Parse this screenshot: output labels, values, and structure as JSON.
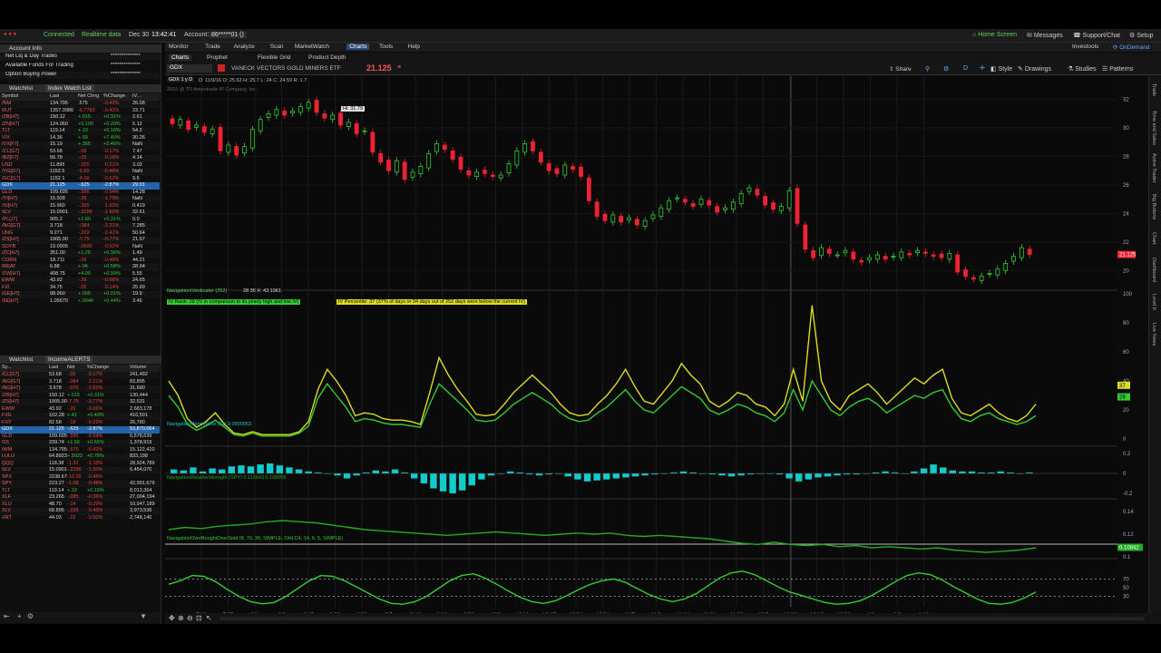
{
  "topbar": {
    "connected": "Connected",
    "realtime": "Realtime data",
    "date": "Dec 30",
    "time": "13:42:41",
    "account_label": "Account:",
    "account": "86*****01 ()",
    "home": "Home Screen",
    "messages": "Messages",
    "support": "Support/Chat",
    "setup": "Setup"
  },
  "account_info": {
    "title": "Account Info",
    "rows": [
      {
        "label": "Net Liq & Day Trades",
        "value": "**************"
      },
      {
        "label": "Available Funds For Trading",
        "value": "**************"
      },
      {
        "label": "Option Buying Power",
        "value": "**************"
      }
    ]
  },
  "watchlist1": {
    "title": "Watchlist",
    "name": "Index Watch List",
    "headers": [
      "Symbol",
      "Last",
      "Net Chng",
      "%Change",
      "IV..."
    ],
    "rows": [
      [
        "/NM",
        "134.795",
        ".575",
        "-0.42%",
        "26.08"
      ],
      [
        "RUT",
        "1357.3986",
        "-5.7783",
        "-0.42%",
        "23.71"
      ],
      [
        "/ZB[H7]",
        "150.12",
        "+.015",
        "+0.31%",
        "2.61"
      ],
      [
        "/ZN[H7]",
        "124.060",
        "+0.100",
        "+0.20%",
        "5.12"
      ],
      [
        "TLT",
        "119.14",
        "+.19",
        "+0.16%",
        "54.2"
      ],
      [
        "VIX",
        "14.36",
        "+.99",
        "+7.40%",
        "30.26"
      ],
      [
        "/VX[F7]",
        "15.19",
        "+.365",
        "+2.46%",
        "NaN"
      ],
      [
        "/CL[G7]",
        "53.68",
        "-.09",
        "-0.17%",
        "7.47"
      ],
      [
        "/BZ[F7]",
        "56.78",
        "-.09",
        "-0.16%",
        "4.14"
      ],
      [
        "USD",
        "11.895",
        "-.025",
        "-0.21%",
        "3.03"
      ],
      [
        "/YG[G7]",
        "1152.5",
        "-5.60",
        "-0.48%",
        "NaN"
      ],
      [
        "/GC[G7]",
        "1152.1",
        "-6.00",
        "-0.52%",
        "9.6"
      ],
      [
        "GDX",
        "21.125",
        "-.625",
        "-2.87%",
        "29.01"
      ],
      [
        "GLD",
        "109.695",
        "-.595",
        "-0.54%",
        "14.28"
      ],
      [
        "/YI[H7]",
        "15.928",
        "-.29",
        "-1.79%",
        "NaN"
      ],
      [
        "/SI[H7]",
        "15.960",
        "-.265",
        "-1.63%",
        "0.419"
      ],
      [
        "SLV",
        "15.0901",
        "-.2299",
        "-1.50%",
        "32.61"
      ],
      [
        "/PL[J7]",
        "905.2",
        "+2.80",
        "+0.31%",
        "0.0"
      ],
      [
        "/NG[G7]",
        "3.718",
        "-.084",
        "-2.21%",
        "7.285"
      ],
      [
        "UNG",
        "9.271",
        "-.229",
        "-2.41%",
        "50.64"
      ],
      [
        "/ZS[H7]",
        "1005.00",
        "-7.75",
        "-0.77%",
        "21.57"
      ],
      [
        "SOYB",
        "19.0905",
        "-.0995",
        "-0.52%",
        "NaN"
      ],
      [
        "/ZC[H7]",
        "351.00",
        "+1.25",
        "+0.36%",
        "1.49"
      ],
      [
        "CORN",
        "18.711",
        "-.09",
        "-0.48%",
        "44.21"
      ],
      [
        "WEAT",
        "6.88",
        "+.04",
        "+0.58%",
        "28.94"
      ],
      [
        "/ZW[H7]",
        "408.75",
        "+4.00",
        "+0.99%",
        "5.55"
      ],
      [
        "EWW",
        "43.92",
        "-.29",
        "-0.66%",
        "24.65"
      ],
      [
        "FXI",
        "34.75",
        "-.05",
        "-0.14%",
        "25.99"
      ],
      [
        "/GE[H7]",
        "98.960",
        "+.005",
        "+0.01%",
        "19.9"
      ],
      [
        "/6E[H7]",
        "1.05670",
        "+.0046",
        "+0.44%",
        "3.46"
      ]
    ]
  },
  "watchlist2": {
    "title": "Watchlist",
    "name": "IncomeALERTS",
    "headers": [
      "Sy...",
      "Last",
      "Net",
      "%Change",
      "Volume"
    ],
    "rows": [
      [
        "/CL[G7]",
        "53.68",
        "-.09",
        "-0.17%",
        "241,492"
      ],
      [
        "/NG[G7]",
        "3.718",
        "-.084",
        "-2.21%",
        "83,895"
      ],
      [
        "/NG[H7]",
        "3.678",
        "-.076",
        "-2.02%",
        "31,680"
      ],
      [
        "/ZB[H7]",
        "150.12",
        "+.015",
        "+0.31%",
        "130,444"
      ],
      [
        "/ZS[H7]",
        "1005.00",
        "-7.75",
        "-0.77%",
        "32,531"
      ],
      [
        "EWW",
        "43.92",
        "-.29",
        "-0.66%",
        "2,683,178"
      ],
      [
        "FXE",
        "102.28",
        "+.41",
        "+0.40%",
        "416,501"
      ],
      [
        "FXY",
        "82.58",
        "-.18",
        "-0.22%",
        "26,780"
      ],
      [
        "GDX",
        "21.125",
        "-.625",
        "-2.87%",
        "53,870,064"
      ],
      [
        "GLD",
        "109.695",
        "-.595",
        "-0.54%",
        "6,578,639"
      ],
      [
        "GS",
        "239.74",
        "+1.56",
        "+0.65%",
        "1,378,919"
      ],
      [
        "IWM",
        "134.795",
        "-.575",
        "-0.42%",
        "15,122,410"
      ],
      [
        "LULU",
        "64.8923",
        "+.5023",
        "+0.78%",
        "833,198"
      ],
      [
        "QQQ",
        "118.38",
        "-1.32",
        "-1.10%",
        "28,924,789"
      ],
      [
        "SLV",
        "15.0901",
        "-.2299",
        "-1.50%",
        "6,454,070"
      ],
      [
        "SPX",
        "2238.67",
        "-10.39",
        "-0.46%",
        ""
      ],
      [
        "SPY",
        "223.27",
        "-1.08",
        "-0.48%",
        "42,991,679"
      ],
      [
        "TLT",
        "119.14",
        "+.19",
        "+0.16%",
        "8,013,364"
      ],
      [
        "XLF",
        "23.265",
        "-.085",
        "-0.36%",
        "27,004,194"
      ],
      [
        "XLU",
        "48.70",
        "-.14",
        "-0.29%",
        "10,947,189"
      ],
      [
        "XLV",
        "68.895",
        "-.295",
        "-0.43%",
        "3,973,536"
      ],
      [
        "XRT",
        "44.03",
        "-.22",
        "-0.50%",
        "2,748,140"
      ]
    ]
  },
  "menus": [
    "Monitor",
    "Trade",
    "Analyze",
    "Scan",
    "MarketWatch",
    "Charts",
    "Tools",
    "Help"
  ],
  "menus_right": [
    "Investools",
    "OnDemand"
  ],
  "subtabs": [
    "Charts",
    "Prophet",
    "Flexible Grid",
    "Product Depth"
  ],
  "symbol": {
    "ticker": "GDX",
    "name": "VANECK VECTORS GOLD MINERS ETF",
    "price": "21.125",
    "share": "Share",
    "style": "Style",
    "drawings": "Drawings",
    "studies": "Studies",
    "patterns": "Patterns",
    "d": "D"
  },
  "chart_header": {
    "title": "GDX 1 y D",
    "ohlc": "D: 11/9/16 O: 25.63 H: 25.7 L: 24 C: 24.59 R: 1.7",
    "copyright": "2016 @ TD Ameritrade IP Company, Inc.",
    "hi_label": "Hi: 31.79"
  },
  "panels": {
    "iv": {
      "label": "NavigationIVindicator (252)",
      "p1": "28",
      "p2": "35",
      "p3": "X: 43.1961",
      "rank": "IV Rank: 29 (IV in comparison to its yearly high and low IV)",
      "pct": "IV Percentile: 37 (37% of days or 94 days out of 252 days were below the current IV)"
    },
    "mf": {
      "label": "NavigationMoneyFlow (21)",
      "v": "0.0000053"
    },
    "rs": {
      "label": "NavigationRelativeStrength (SPY)",
      "v1": "0.113643",
      "v2": "0.108058"
    },
    "obos": {
      "label": "NavigationOverBoughtOverSold (8, 70, 30, SIMPLE, OHLC4, 14, 6, 5, SIMPLE)"
    }
  },
  "chart_data": {
    "type": "line",
    "title": "GDX 1 y D",
    "price_axis": [
      "32",
      "30",
      "28",
      "26",
      "24",
      "22",
      "20"
    ],
    "price_tag": "21.125",
    "iv_axis": [
      "100",
      "80",
      "60",
      "40",
      "20",
      "0"
    ],
    "iv_tags": [
      "37",
      "29"
    ],
    "mf_axis": [
      "0.2",
      "0",
      "-0.2"
    ],
    "rs_axis": [
      "0.14",
      "0.12",
      "0.1"
    ],
    "rs_tag": "0.10842",
    "obos_axis": [
      "70",
      "50",
      "30"
    ],
    "x_labels": [
      "7/18",
      "7/25",
      "8/1",
      "8/8",
      "8/15",
      "8/22",
      "8/29",
      "9/5",
      "9/12",
      "9/19",
      "9/26",
      "10/3",
      "10/10",
      "10/17",
      "10/24",
      "10/31",
      "11/7",
      "11/9",
      "11/14",
      "11/21",
      "11/28",
      "12/5",
      "12/12",
      "12/19",
      "12/26",
      "1/2",
      "1/9",
      "1/16"
    ],
    "closes": [
      30.3,
      30.6,
      29.9,
      30.2,
      29.7,
      29.9,
      28.4,
      28.8,
      28.1,
      28.7,
      29.9,
      30.6,
      31.0,
      31.3,
      30.9,
      31.2,
      31.5,
      31.8,
      31.1,
      30.7,
      30.9,
      30.2,
      30.4,
      29.6,
      29.8,
      28.3,
      27.6,
      27.0,
      27.7,
      26.4,
      26.9,
      27.3,
      28.2,
      28.9,
      28.5,
      27.8,
      27.1,
      26.7,
      26.9,
      26.8,
      26.6,
      26.7,
      27.5,
      28.4,
      28.9,
      28.4,
      27.6,
      27.0,
      26.8,
      27.4,
      27.1,
      26.6,
      24.9,
      23.8,
      23.5,
      23.9,
      23.4,
      23.7,
      23.2,
      23.5,
      23.9,
      24.4,
      24.9,
      25.1,
      24.8,
      24.5,
      25.0,
      24.6,
      24.1,
      24.4,
      24.8,
      25.4,
      25.8,
      25.3,
      24.6,
      24.3,
      24.5,
      25.6,
      23.3,
      21.5,
      20.9,
      21.6,
      21.2,
      21.1,
      21.4,
      20.8,
      20.6,
      20.9,
      21.1,
      20.8,
      21.0,
      21.3,
      21.1,
      21.4,
      21.2,
      21.0,
      20.9,
      21.2,
      19.9,
      19.6,
      19.4,
      19.6,
      19.8,
      20.1,
      20.5,
      21.0,
      21.6,
      21.13
    ],
    "iv_rank": [
      30,
      22,
      10,
      6,
      9,
      13,
      8,
      3,
      2,
      4,
      2,
      2,
      2,
      2,
      4,
      9,
      28,
      38,
      30,
      22,
      12,
      14,
      13,
      11,
      10,
      10,
      9,
      8,
      24,
      38,
      32,
      26,
      20,
      13,
      12,
      13,
      18,
      24,
      28,
      32,
      28,
      24,
      18,
      14,
      12,
      13,
      18,
      22,
      28,
      34,
      26,
      20,
      18,
      24,
      30,
      36,
      32,
      28,
      20,
      17,
      20,
      24,
      22,
      18,
      16,
      12,
      18,
      34,
      20,
      40,
      30,
      20,
      16,
      22,
      26,
      28,
      24,
      18,
      22,
      26,
      30,
      28,
      32,
      34,
      22,
      14,
      12,
      16,
      18,
      14,
      12,
      10,
      12,
      16
    ],
    "iv_pct": [
      40,
      30,
      14,
      8,
      12,
      18,
      10,
      4,
      3,
      5,
      3,
      3,
      3,
      3,
      5,
      12,
      34,
      48,
      40,
      30,
      16,
      18,
      17,
      14,
      13,
      13,
      12,
      10,
      32,
      56,
      44,
      34,
      26,
      17,
      16,
      17,
      24,
      32,
      38,
      44,
      38,
      32,
      24,
      18,
      16,
      17,
      24,
      30,
      38,
      48,
      36,
      26,
      24,
      32,
      40,
      52,
      44,
      38,
      26,
      22,
      26,
      32,
      30,
      24,
      22,
      16,
      24,
      48,
      26,
      92,
      40,
      26,
      20,
      30,
      34,
      38,
      32,
      24,
      30,
      36,
      42,
      38,
      44,
      48,
      28,
      18,
      16,
      20,
      24,
      18,
      14,
      12,
      16,
      24
    ],
    "money_flow": [
      0.04,
      0.03,
      0.06,
      0.02,
      0.05,
      0.04,
      0.07,
      0.08,
      0.07,
      0.09,
      0.1,
      0.08,
      0.06,
      0.04,
      0.02,
      0.01,
      0,
      -0.02,
      -0.05,
      -0.02,
      0.01,
      0.03,
      0.02,
      0.04,
      0.01,
      -0.05,
      -0.1,
      -0.15,
      -0.18,
      -0.2,
      -0.17,
      -0.12,
      -0.06,
      -0.02,
      0,
      0.02,
      0.01,
      -0.01,
      -0.02,
      -0.01,
      0,
      -0.03,
      -0.06,
      -0.08,
      -0.07,
      -0.06,
      -0.05,
      -0.04,
      -0.03,
      -0.02,
      -0.01,
      0,
      0.01,
      0.02,
      0.01,
      0,
      -0.01,
      -0.02,
      -0.03,
      -0.02,
      -0.01,
      0,
      0,
      -0.01,
      -0.05,
      -0.08,
      -0.06,
      -0.04,
      -0.03,
      -0.02,
      -0.01,
      -0.01,
      0,
      0.01,
      0.02,
      0.01,
      0,
      0.02,
      0.05,
      0.09,
      0.06,
      0.03,
      0.02,
      0.02,
      0.01,
      0.01,
      0.02,
      0.01,
      0,
      0.01
    ],
    "rel_strength": [
      0.124,
      0.126,
      0.125,
      0.127,
      0.128,
      0.129,
      0.131,
      0.132,
      0.131,
      0.13,
      0.128,
      0.126,
      0.124,
      0.123,
      0.122,
      0.121,
      0.12,
      0.119,
      0.12,
      0.121,
      0.122,
      0.121,
      0.12,
      0.119,
      0.12,
      0.121,
      0.12,
      0.121,
      0.119,
      0.118,
      0.119,
      0.118,
      0.117,
      0.116,
      0.114,
      0.112,
      0.111,
      0.113,
      0.111,
      0.11,
      0.111,
      0.109,
      0.11,
      0.108,
      0.109,
      0.108,
      0.107,
      0.108,
      0.106,
      0.105,
      0.104,
      0.105,
      0.106,
      0.108
    ],
    "obos": [
      58,
      66,
      78,
      76,
      64,
      46,
      30,
      18,
      13,
      16,
      30,
      48,
      66,
      78,
      76,
      66,
      52,
      38,
      24,
      14,
      12,
      18,
      30,
      48,
      66,
      78,
      82,
      72,
      58,
      42,
      28,
      18,
      14,
      20,
      32,
      46,
      58,
      66,
      70,
      62,
      48,
      34,
      24,
      18,
      24,
      36,
      54,
      72,
      84,
      88,
      80,
      66,
      52,
      40,
      32,
      24,
      16,
      12,
      14,
      20,
      32,
      48,
      64,
      78,
      84,
      80,
      68,
      52,
      38,
      24,
      14,
      12,
      16,
      26,
      40
    ]
  }
}
